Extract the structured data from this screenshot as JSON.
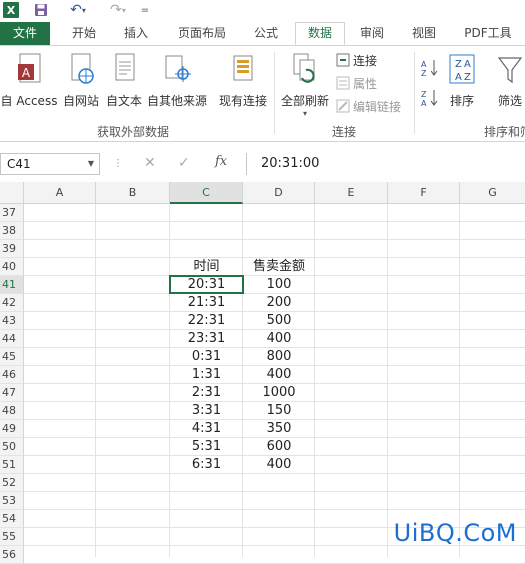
{
  "qat": {
    "app_icon": "X",
    "customize": "="
  },
  "tabs": [
    "文件",
    "开始",
    "插入",
    "页面布局",
    "公式",
    "数据",
    "审阅",
    "视图",
    "PDF工具"
  ],
  "ribbon": {
    "get_external": {
      "buttons": [
        "自 Access",
        "自网站",
        "自文本",
        "自其他来源"
      ],
      "label": "获取外部数据"
    },
    "existing_conn": "现有连接",
    "connections": {
      "refresh_all": "全部刷新",
      "small": [
        "连接",
        "属性",
        "编辑链接"
      ],
      "label": "连接"
    },
    "sort_filter": {
      "sort": "排序",
      "filter": "筛选",
      "label": "排序和筛选"
    }
  },
  "formula_bar": {
    "name_box": "C41",
    "cancel": "✕",
    "enter": "✓",
    "fx": "fx",
    "content": "20:31:00"
  },
  "grid": {
    "columns": [
      "A",
      "B",
      "C",
      "D",
      "E",
      "F",
      "G"
    ],
    "row_numbers": [
      "37",
      "38",
      "39",
      "40",
      "41",
      "42",
      "43",
      "44",
      "45",
      "46",
      "47",
      "48",
      "49",
      "50",
      "51",
      "52",
      "53",
      "54",
      "55",
      "56"
    ],
    "header_row": {
      "time": "时间",
      "amount": "售卖金额"
    },
    "data": [
      {
        "time": "20:31",
        "amount": "100"
      },
      {
        "time": "21:31",
        "amount": "200"
      },
      {
        "time": "22:31",
        "amount": "500"
      },
      {
        "time": "23:31",
        "amount": "400"
      },
      {
        "time": "0:31",
        "amount": "800"
      },
      {
        "time": "1:31",
        "amount": "400"
      },
      {
        "time": "2:31",
        "amount": "1000"
      },
      {
        "time": "3:31",
        "amount": "150"
      },
      {
        "time": "4:31",
        "amount": "350"
      },
      {
        "time": "5:31",
        "amount": "600"
      },
      {
        "time": "6:31",
        "amount": "400"
      }
    ]
  },
  "watermark": "UiBQ.CoM"
}
